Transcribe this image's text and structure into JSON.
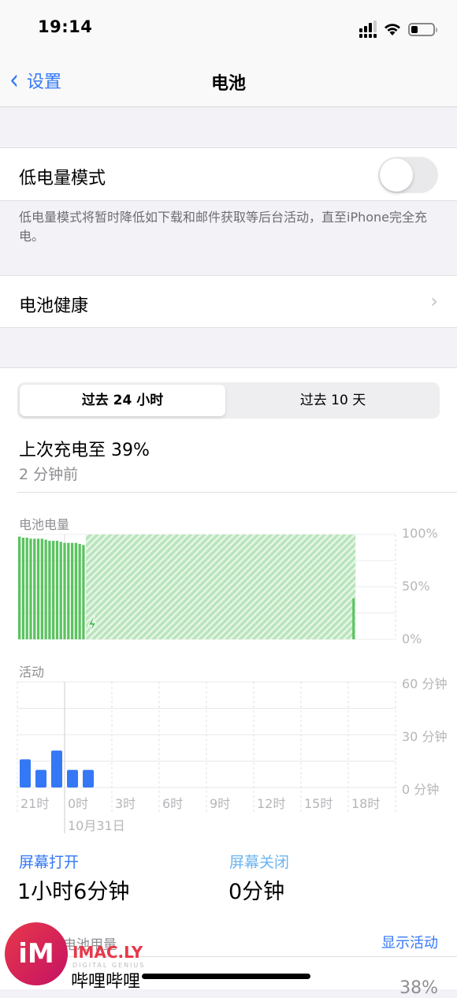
{
  "status_bar": {
    "time": "19:14",
    "icons": [
      "cellular-signal-icon",
      "wifi-icon",
      "battery-icon"
    ],
    "battery_level": 0.3
  },
  "navbar": {
    "back_label": "设置",
    "back_icon": "chevron-left-icon",
    "title": "电池"
  },
  "low_power": {
    "label": "低电量模式",
    "enabled": false,
    "footnote": "低电量模式将暂时降低如下载和邮件获取等后台活动，直至iPhone完全充电。"
  },
  "battery_health": {
    "label": "电池健康",
    "icon": "chevron-right-icon"
  },
  "segmented": {
    "options": [
      "过去 24 小时",
      "过去 10 天"
    ],
    "selected": 0
  },
  "last_charge": {
    "title": "上次充电至 39%",
    "time": "2 分钟前"
  },
  "colors": {
    "accent": "#3478f6",
    "battery_green": "#5bc360",
    "charging_hatch": "#c6ebc9",
    "activity_blue": "#3478f6",
    "screen_off_blue": "#6cb4f0"
  },
  "chart_data": [
    {
      "type": "bar",
      "title": "电池电量",
      "ylabel": "",
      "ylim": [
        0,
        100
      ],
      "y_ticks": [
        "100%",
        "50%",
        "0%"
      ],
      "series": [
        {
          "name": "battery_level_percent",
          "values": [
            98,
            97,
            97,
            96,
            96,
            96,
            96,
            95,
            94,
            94,
            94,
            93,
            92,
            92,
            92,
            92,
            91,
            90
          ]
        },
        {
          "name": "charging_window",
          "from_bar": 18,
          "to_fraction": 0.89,
          "value": 100
        },
        {
          "name": "current_level",
          "value": 39
        }
      ],
      "annotations": [
        "charging-bolt-icon"
      ]
    },
    {
      "type": "bar",
      "title": "活动",
      "ylim": [
        0,
        60
      ],
      "y_ticks": [
        "60 分钟",
        "30 分钟",
        "0 分钟"
      ],
      "categories": [
        "21时",
        "0时",
        "3时",
        "6时",
        "9时",
        "12时",
        "15时",
        "18时"
      ],
      "date_label": "10月31日",
      "series": [
        {
          "name": "screen_on_minutes",
          "values": [
            16,
            10,
            21,
            10,
            10
          ]
        }
      ]
    }
  ],
  "stats": {
    "screen_on": {
      "label": "屏幕打开",
      "value": "1小时6分钟"
    },
    "screen_off": {
      "label": "屏幕关闭",
      "value": "0分钟"
    }
  },
  "usage": {
    "header": "电池用量",
    "show_activity": "显示活动",
    "apps": [
      {
        "name": "哔哩哔哩",
        "percent": "38%"
      }
    ]
  },
  "watermark": {
    "logo": "iM",
    "text": "IMAC.LY",
    "sub": "DIGITAL GENIUS"
  }
}
